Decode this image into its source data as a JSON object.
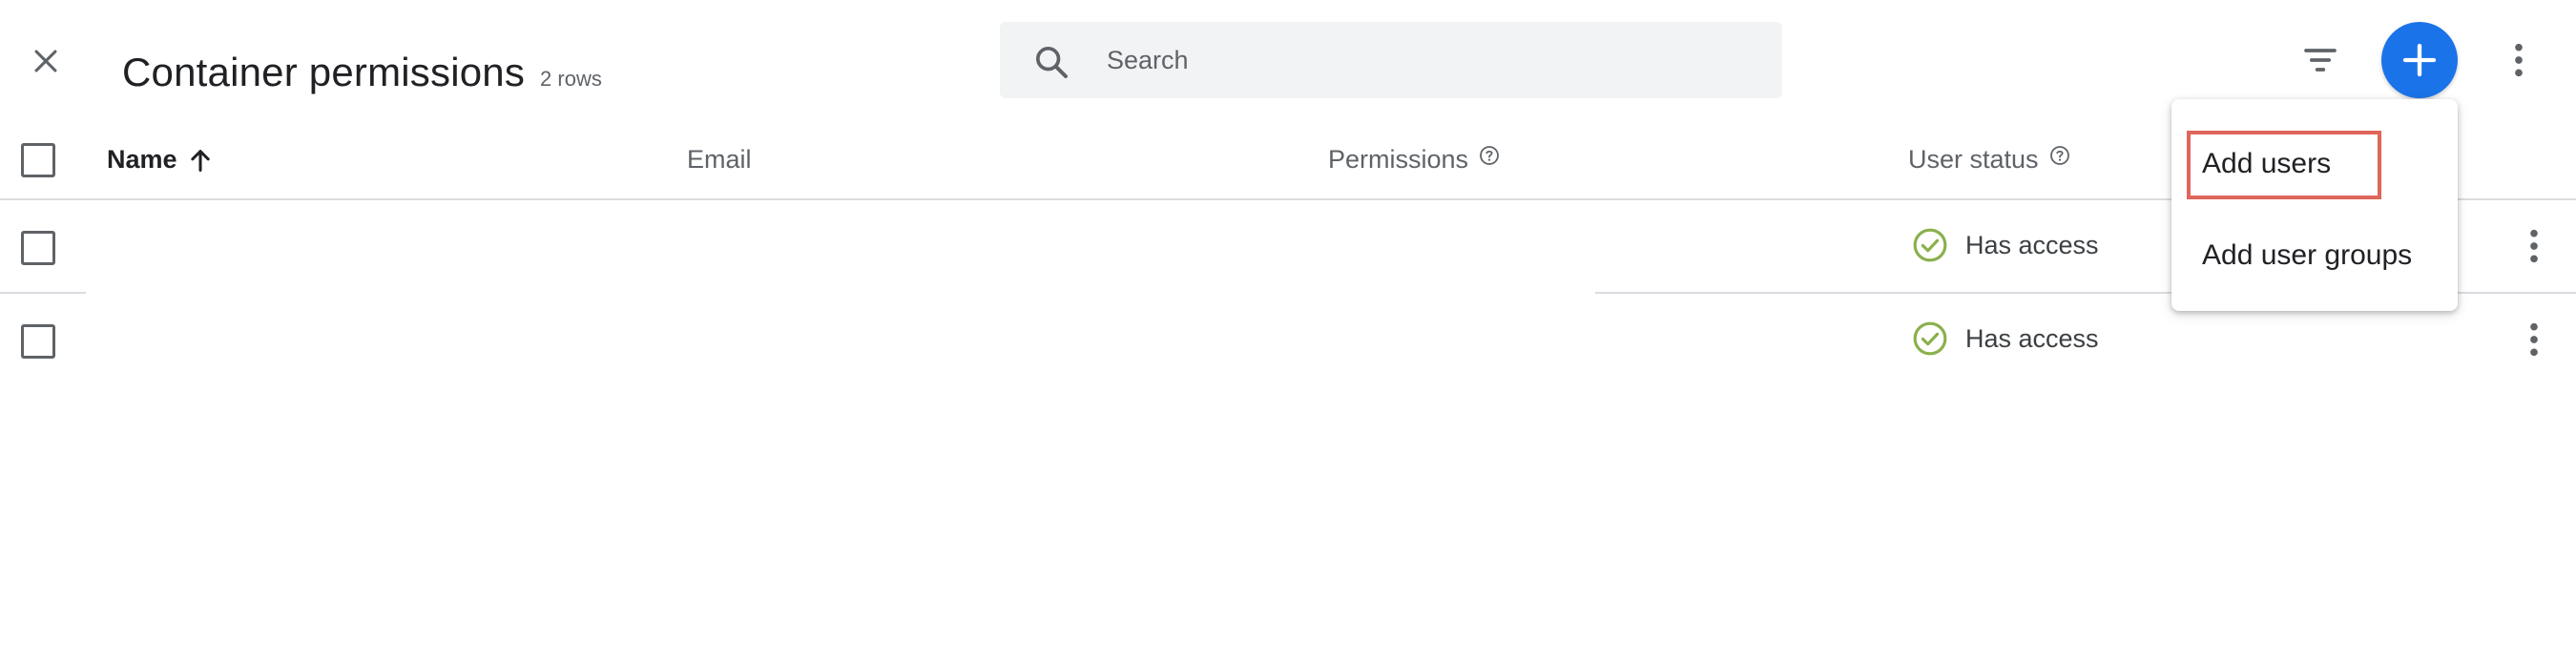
{
  "app": {
    "title": "Container permissions",
    "row_count": "2 rows"
  },
  "search": {
    "placeholder": "Search",
    "value": ""
  },
  "colors": {
    "accent": "#1a73e8",
    "status_ok": "#8ab04b",
    "highlight": "#e0655a"
  },
  "table": {
    "columns": [
      {
        "label": "Name",
        "sort": "ascending",
        "sort_icon": "arrow-up-icon"
      },
      {
        "label": "Email"
      },
      {
        "label": "Permissions",
        "help_icon": "help-circle-icon"
      },
      {
        "label": "User status",
        "help_icon": "help-circle-icon"
      }
    ],
    "rows": [
      {
        "name": "",
        "email": "",
        "permissions": "",
        "status": "Has access",
        "status_icon": "check-circle-icon"
      },
      {
        "name": "",
        "email": "",
        "permissions": "",
        "status": "Has access",
        "status_icon": "check-circle-icon"
      }
    ]
  },
  "add_menu": {
    "items": [
      {
        "label": "Add users",
        "highlighted": true
      },
      {
        "label": "Add user groups",
        "highlighted": false
      }
    ]
  }
}
